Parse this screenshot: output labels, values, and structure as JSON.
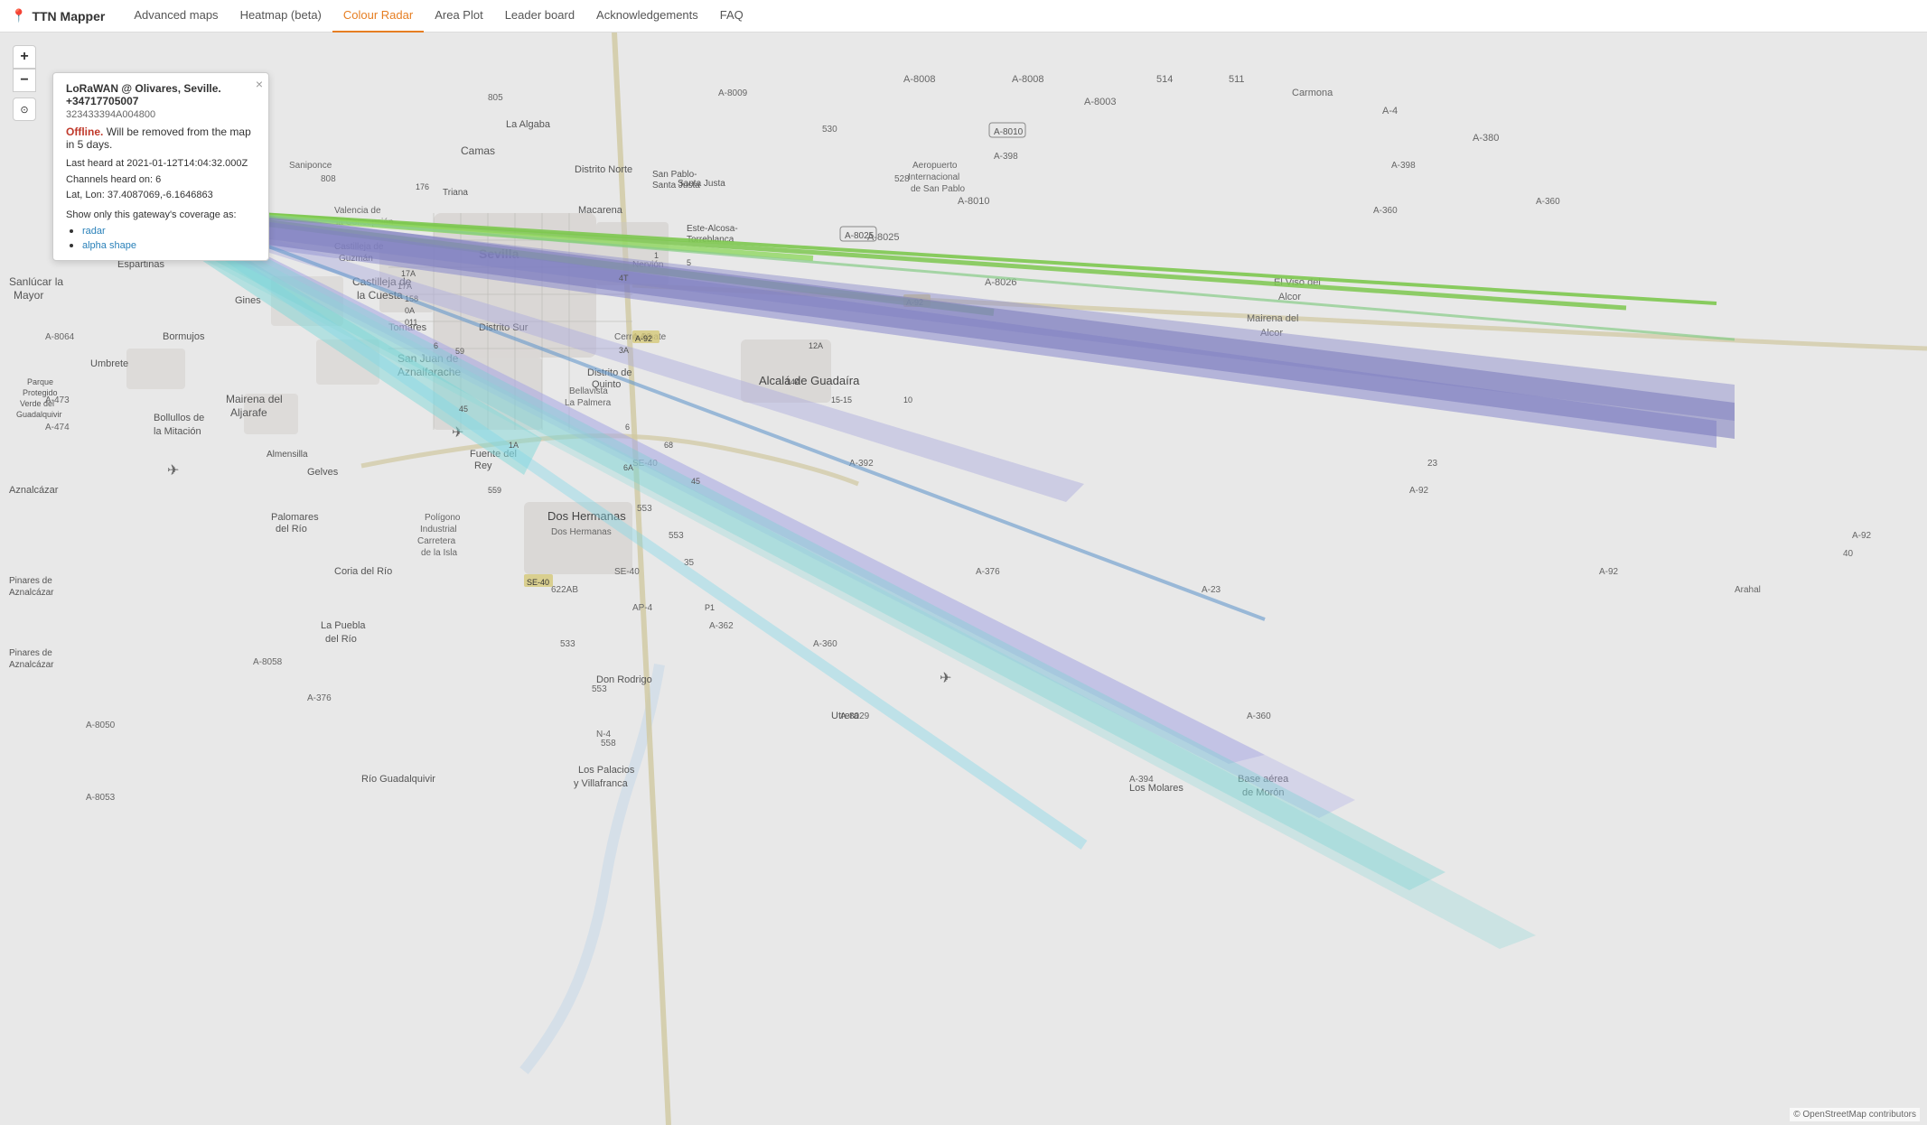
{
  "brand": {
    "name": "TTN Mapper",
    "icon": "📍"
  },
  "nav": {
    "links": [
      {
        "id": "advanced-maps",
        "label": "Advanced maps",
        "active": false
      },
      {
        "id": "heatmap-beta",
        "label": "Heatmap (beta)",
        "active": false
      },
      {
        "id": "colour-radar",
        "label": "Colour Radar",
        "active": true
      },
      {
        "id": "area-plot",
        "label": "Area Plot",
        "active": false
      },
      {
        "id": "leader-board",
        "label": "Leader board",
        "active": false
      },
      {
        "id": "acknowledgements",
        "label": "Acknowledgements",
        "active": false
      },
      {
        "id": "faq",
        "label": "FAQ",
        "active": false
      }
    ]
  },
  "map_controls": {
    "zoom_in": "+",
    "zoom_out": "−",
    "compass": "⊙"
  },
  "popup": {
    "title": "LoRaWAN @ Olivares, Seville. +34717705007",
    "gateway_id": "323433394A004800",
    "status": "Offline.",
    "status_msg": " Will be removed from the map in 5 days.",
    "last_heard": "Last heard at 2021-01-12T14:04:32.000Z",
    "channels": "Channels heard on: 6",
    "location": "Lat, Lon: 37.4087069,-6.1646863",
    "coverage_label": "Show only this gateway's coverage as:",
    "coverage_links": [
      {
        "label": "radar",
        "href": "#"
      },
      {
        "label": "alpha shape",
        "href": "#"
      }
    ],
    "close": "×"
  },
  "map": {
    "center_city": "Sevilla",
    "zoom": 11
  }
}
